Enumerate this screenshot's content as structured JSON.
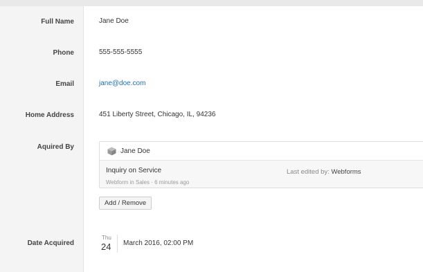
{
  "fields": {
    "full_name": {
      "label": "Full Name",
      "value": "Jane Doe"
    },
    "phone": {
      "label": "Phone",
      "value": "555-555-5555"
    },
    "email": {
      "label": "Email",
      "value": "jane@doe.com"
    },
    "home_address": {
      "label": "Home Address",
      "value": "451 Liberty Street, Chicago, IL, 94236"
    },
    "acquired_by": {
      "label": "Aquired By"
    },
    "date_acquired": {
      "label": "Date Acquired"
    }
  },
  "acquired_card": {
    "owner": "Jane Doe",
    "icon": "cube-icon",
    "title": "Inquiry on Service",
    "meta": "Webform in Sales · 6 minutes ago",
    "edited_prefix": "Last edited by: ",
    "edited_by": "Webforms"
  },
  "add_remove_label": "Add / Remove",
  "date": {
    "weekday": "Thu",
    "day": "24",
    "full": "March 2016, 02:00 PM"
  },
  "colors": {
    "link": "#1f6fb2",
    "sidebar_bg": "#f4f4f4",
    "card_body_bg": "#f7f7f7"
  }
}
